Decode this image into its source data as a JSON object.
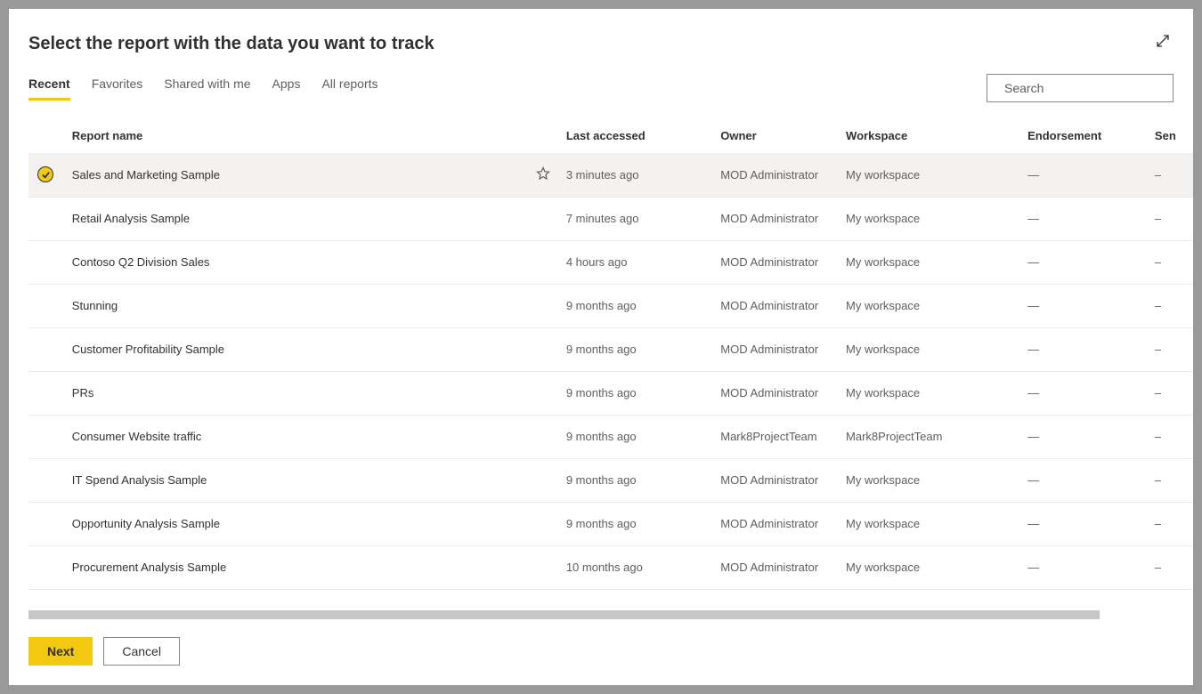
{
  "modal": {
    "title": "Select the report with the data you want to track"
  },
  "tabs": [
    {
      "label": "Recent",
      "active": true
    },
    {
      "label": "Favorites",
      "active": false
    },
    {
      "label": "Shared with me",
      "active": false
    },
    {
      "label": "Apps",
      "active": false
    },
    {
      "label": "All reports",
      "active": false
    }
  ],
  "search": {
    "placeholder": "Search"
  },
  "columns": {
    "name": "Report name",
    "accessed": "Last accessed",
    "owner": "Owner",
    "workspace": "Workspace",
    "endorsement": "Endorsement",
    "sensitivity": "Sen"
  },
  "rows": [
    {
      "name": "Sales and Marketing Sample",
      "accessed": "3 minutes ago",
      "owner": "MOD Administrator",
      "workspace": "My workspace",
      "endorsement": "—",
      "sensitivity": "–",
      "selected": true,
      "favorite": true
    },
    {
      "name": "Retail Analysis Sample",
      "accessed": "7 minutes ago",
      "owner": "MOD Administrator",
      "workspace": "My workspace",
      "endorsement": "—",
      "sensitivity": "–",
      "selected": false,
      "favorite": false
    },
    {
      "name": "Contoso Q2 Division Sales",
      "accessed": "4 hours ago",
      "owner": "MOD Administrator",
      "workspace": "My workspace",
      "endorsement": "—",
      "sensitivity": "–",
      "selected": false,
      "favorite": false
    },
    {
      "name": "Stunning",
      "accessed": "9 months ago",
      "owner": "MOD Administrator",
      "workspace": "My workspace",
      "endorsement": "—",
      "sensitivity": "–",
      "selected": false,
      "favorite": false
    },
    {
      "name": "Customer Profitability Sample",
      "accessed": "9 months ago",
      "owner": "MOD Administrator",
      "workspace": "My workspace",
      "endorsement": "—",
      "sensitivity": "–",
      "selected": false,
      "favorite": false
    },
    {
      "name": "PRs",
      "accessed": "9 months ago",
      "owner": "MOD Administrator",
      "workspace": "My workspace",
      "endorsement": "—",
      "sensitivity": "–",
      "selected": false,
      "favorite": false
    },
    {
      "name": "Consumer Website traffic",
      "accessed": "9 months ago",
      "owner": "Mark8ProjectTeam",
      "workspace": "Mark8ProjectTeam",
      "endorsement": "—",
      "sensitivity": "–",
      "selected": false,
      "favorite": false
    },
    {
      "name": "IT Spend Analysis Sample",
      "accessed": "9 months ago",
      "owner": "MOD Administrator",
      "workspace": "My workspace",
      "endorsement": "—",
      "sensitivity": "–",
      "selected": false,
      "favorite": false
    },
    {
      "name": "Opportunity Analysis Sample",
      "accessed": "9 months ago",
      "owner": "MOD Administrator",
      "workspace": "My workspace",
      "endorsement": "—",
      "sensitivity": "–",
      "selected": false,
      "favorite": false
    },
    {
      "name": "Procurement Analysis Sample",
      "accessed": "10 months ago",
      "owner": "MOD Administrator",
      "workspace": "My workspace",
      "endorsement": "—",
      "sensitivity": "–",
      "selected": false,
      "favorite": false
    }
  ],
  "footer": {
    "next": "Next",
    "cancel": "Cancel"
  }
}
